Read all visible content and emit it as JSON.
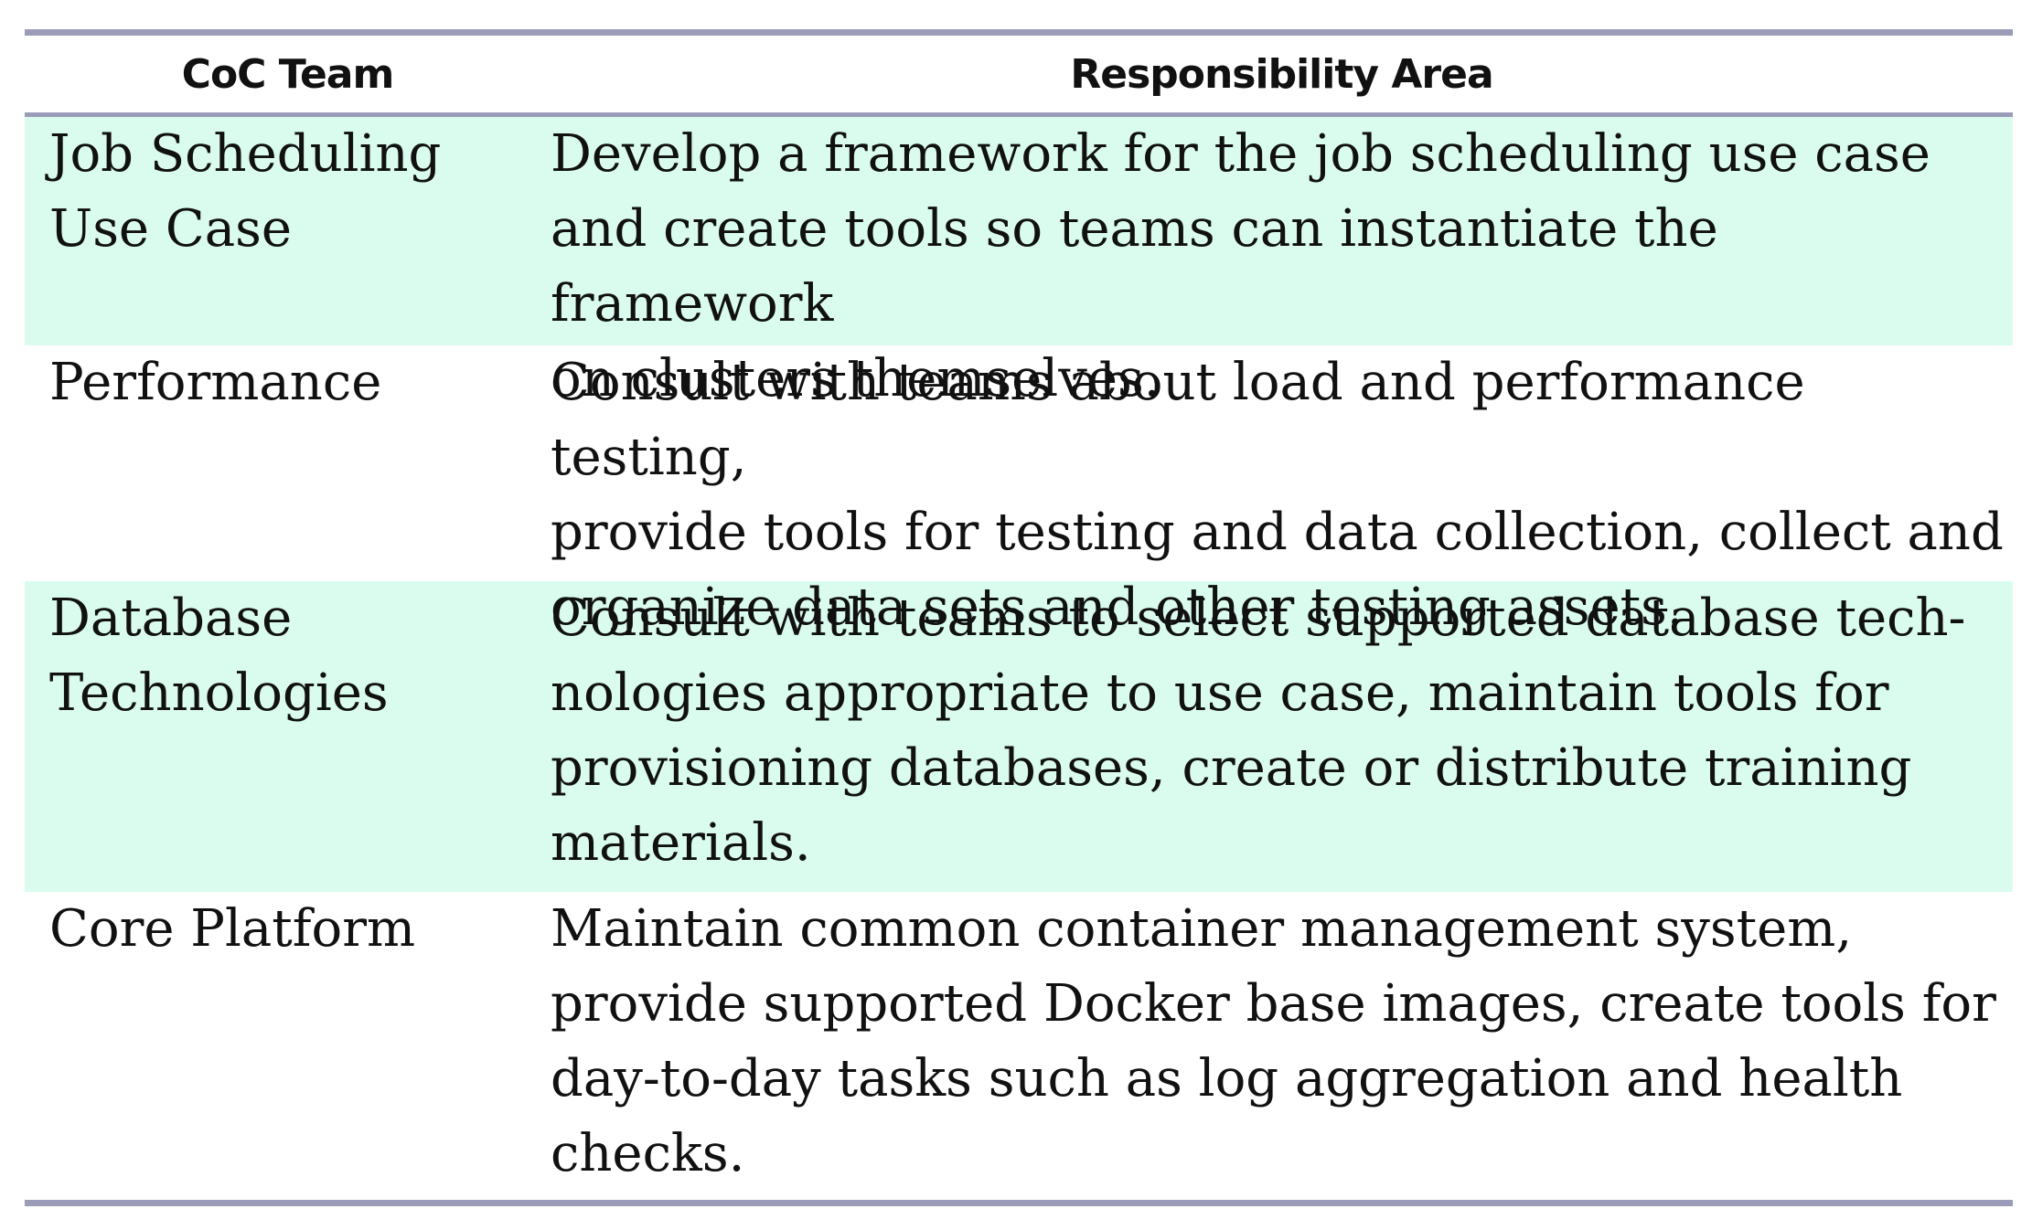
{
  "table": {
    "headers": {
      "team": "CoC Team",
      "responsibility": "Responsibility Area"
    },
    "rows": [
      {
        "team": "Job Scheduling\nUse Case",
        "responsibility": "Develop a framework for the job scheduling use case\nand create tools so teams can instantiate the framework\non clusters themselves."
      },
      {
        "team": "Performance",
        "responsibility": "Consult with teams about load and performance testing,\nprovide tools for testing and data collection, collect and\norganize data sets and other testing assets."
      },
      {
        "team": "Database\nTechnologies",
        "responsibility": "Consult with teams to select supported database tech-\nnologies appropriate to use case, maintain tools for\nprovisioning databases, create or distribute training\nmaterials."
      },
      {
        "team": "Core Platform",
        "responsibility": "Maintain common container management system,\nprovide supported Docker base images, create tools for\nday-to-day tasks such as log aggregation and health\nchecks."
      }
    ],
    "colors": {
      "rule": "#9a9cb8",
      "shaded_row": "#dafcee"
    }
  }
}
